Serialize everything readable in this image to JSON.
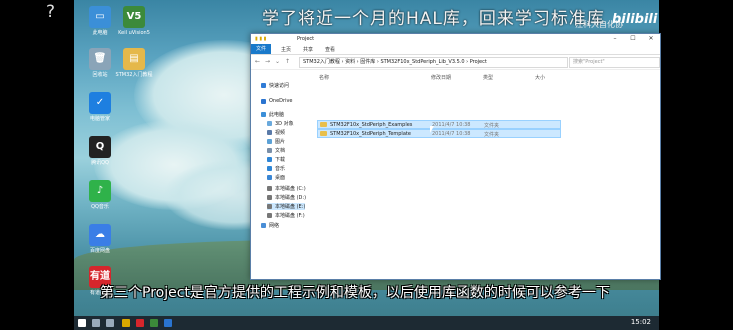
{
  "overlay": {
    "help": "?",
    "banner": "学了将近一个月的HAL库，回来学习标准库",
    "bili_logo": "bilibili",
    "bili_watermark": "江科大自化协",
    "caption": "第三个Project是官方提供的工程示例和模板，以后使用库函数的时候可以参考一下"
  },
  "desktop_icons": [
    {
      "label": "此电脑",
      "color": "#3b8fd8",
      "glyph": "▭"
    },
    {
      "label": "Keil uVision5",
      "color": "#3c8a3a",
      "glyph": "V5"
    },
    {
      "label": "回收站",
      "color": "#8aa4b8",
      "glyph": "🗑"
    },
    {
      "label": "STM32入门教程",
      "color": "#e5b84a",
      "glyph": "▤"
    },
    {
      "label": "电脑管家",
      "color": "#1e7fe0",
      "glyph": "✓"
    },
    {
      "label": "腾讯QQ",
      "color": "#222",
      "glyph": "Q"
    },
    {
      "label": "QQ音乐",
      "color": "#2fb24a",
      "glyph": "♪"
    },
    {
      "label": "百度网盘",
      "color": "#3a7ee6",
      "glyph": "☁"
    },
    {
      "label": "有道翻译",
      "color": "#d6262c",
      "glyph": "有道"
    }
  ],
  "window": {
    "title": "Project",
    "controls": [
      "–",
      "☐",
      "✕"
    ],
    "ribbon_tabs": [
      "文件",
      "主页",
      "共享",
      "查看"
    ],
    "breadcrumb": "STM32入门教程  ›  资料  ›  固件库  ›  STM32F10x_StdPeriph_Lib_V3.5.0  ›  Project",
    "search_placeholder": "搜索\"Project\"",
    "nav": [
      {
        "label": "快速访问",
        "color": "#2f7bd6"
      },
      {
        "label": "OneDrive",
        "color": "#2a74d0"
      },
      {
        "label": "此电脑",
        "color": "#3b8fd8"
      },
      {
        "label": "3D 对象",
        "color": "#6aa9dc"
      },
      {
        "label": "视频",
        "color": "#5a7aa8"
      },
      {
        "label": "图片",
        "color": "#5ba1d6"
      },
      {
        "label": "文档",
        "color": "#7a8fa8"
      },
      {
        "label": "下载",
        "color": "#2f86d6"
      },
      {
        "label": "音乐",
        "color": "#2f86d6"
      },
      {
        "label": "桌面",
        "color": "#3a86d4"
      },
      {
        "label": "本地磁盘 (C:)",
        "color": "#777"
      },
      {
        "label": "本地磁盘 (D:)",
        "color": "#777"
      },
      {
        "label": "本地磁盘 (E:)",
        "color": "#777"
      },
      {
        "label": "本地磁盘 (F:)",
        "color": "#777"
      },
      {
        "label": "网络",
        "color": "#4a8ed6"
      }
    ],
    "columns": {
      "name": "名称",
      "date": "修改日期",
      "type": "类型",
      "size": "大小"
    },
    "files": [
      {
        "name": "STM32F10x_StdPeriph_Examples",
        "date": "2011/4/7 10:38",
        "type": "文件夹"
      },
      {
        "name": "STM32F10x_StdPeriph_Template",
        "date": "2011/4/7 10:38",
        "type": "文件夹"
      }
    ]
  },
  "taskbar": {
    "time": "15:02"
  }
}
